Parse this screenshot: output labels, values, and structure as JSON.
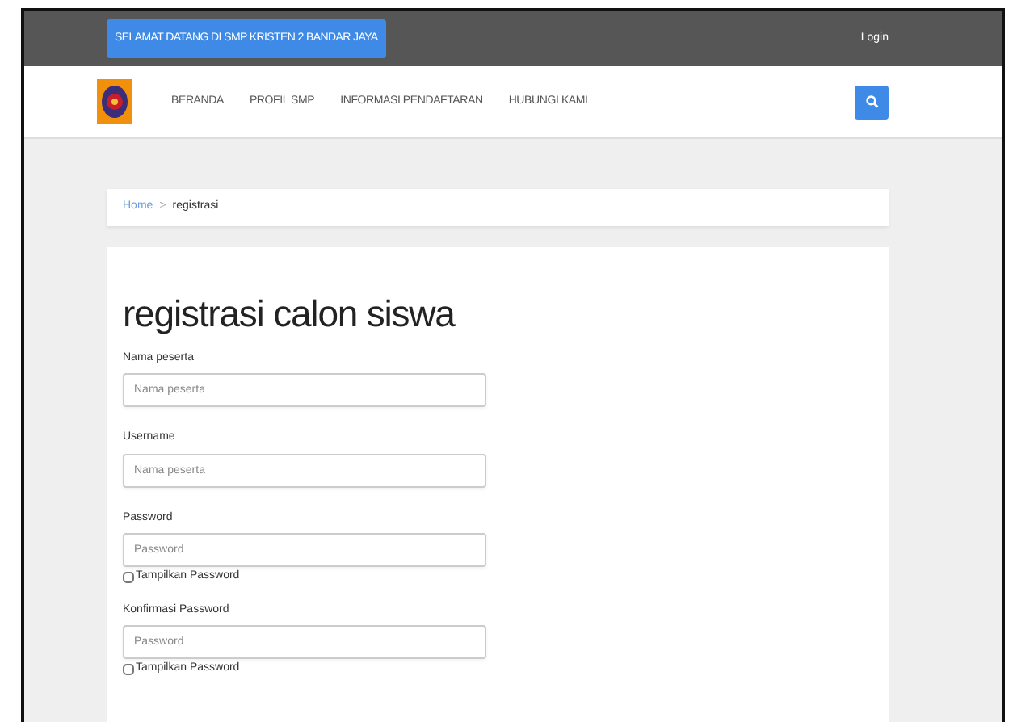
{
  "topbar": {
    "welcome": "SELAMAT DATANG DI SMP KRISTEN 2 BANDAR JAYA",
    "login": "Login"
  },
  "nav": {
    "items": [
      {
        "label": "BERANDA"
      },
      {
        "label": "PROFIL SMP"
      },
      {
        "label": "INFORMASI PENDAFTARAN"
      },
      {
        "label": "HUBUNGI KAMI"
      }
    ]
  },
  "breadcrumb": [
    {
      "label": "Home",
      "kind": "link"
    },
    {
      "label": ">",
      "kind": "separator"
    },
    {
      "label": "registrasi",
      "kind": "current"
    }
  ],
  "title": "registrasi calon siswa",
  "fields": [
    {
      "label": "Nama peserta",
      "placeholder": "Nama peserta"
    },
    {
      "label": "Username",
      "placeholder": "Nama peserta"
    },
    {
      "label": "Password",
      "placeholder": "Password",
      "toggle": {
        "label": "Tampilkan Password",
        "checked": false
      }
    },
    {
      "label": "Konfirmasi Password",
      "placeholder": "Password",
      "toggle": {
        "label": "Tampilkan Password",
        "checked": false
      }
    }
  ]
}
